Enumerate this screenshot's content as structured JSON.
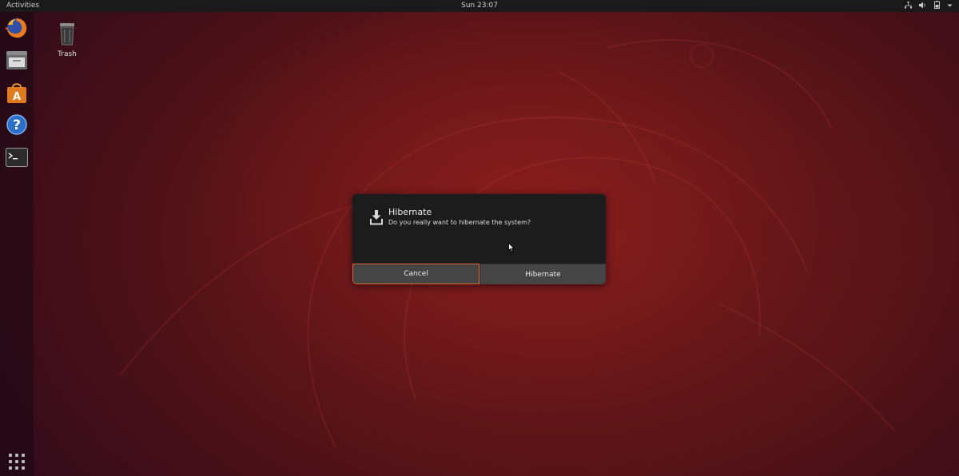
{
  "topbar": {
    "activities": "Activities",
    "clock": "Sun 23:07",
    "tray_icons": [
      "network-icon",
      "volume-icon",
      "battery-icon",
      "menu-arrow-icon"
    ]
  },
  "dock": {
    "items": [
      {
        "name": "Firefox",
        "icon": "firefox-icon"
      },
      {
        "name": "Files",
        "icon": "files-icon"
      },
      {
        "name": "Ubuntu Software",
        "icon": "software-icon"
      },
      {
        "name": "Help",
        "icon": "help-icon"
      },
      {
        "name": "Terminal",
        "icon": "terminal-icon"
      }
    ],
    "show_apps_icon": "apps-grid-icon"
  },
  "desktop": {
    "trash_label": "Trash"
  },
  "dialog": {
    "title": "Hibernate",
    "message": "Do you really want to hibernate the system?",
    "cancel_label": "Cancel",
    "confirm_label": "Hibernate",
    "accent_color": "#e0662b"
  }
}
